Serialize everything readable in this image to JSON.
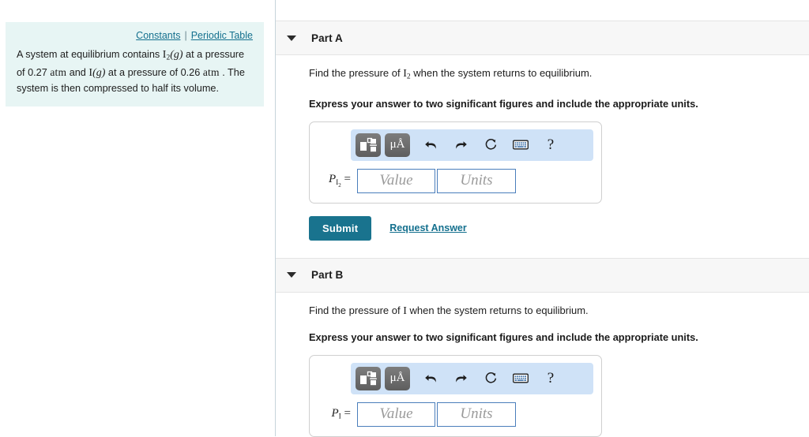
{
  "left_panel": {
    "links": [
      {
        "label": "Constants",
        "name": "constants-link"
      },
      {
        "label": "Periodic Table",
        "name": "periodic-table-link"
      }
    ],
    "link_separator": "|",
    "problem": {
      "seg1": "A system at equilibrium contains ",
      "species1": "I",
      "species1_sub": "2",
      "species1_state": "(g)",
      "seg2": " at a pressure of 0.27 ",
      "unit1": "atm",
      "seg3": " and ",
      "species2": "I",
      "species2_state": "(g)",
      "seg4": " at a pressure of 0.26 ",
      "unit2": "atm",
      "seg5": " . The system is then compressed to half its volume."
    }
  },
  "parts": [
    {
      "id": "part-a",
      "title": "Part A",
      "caret": "caret-down-icon",
      "question_pre": "Find the pressure of ",
      "question_symbol": "I",
      "question_symbol_sub": "2",
      "question_post": " when the system returns to equilibrium.",
      "instruction": "Express your answer to two significant figures and include the appropriate units.",
      "answer_label_base": "P",
      "answer_label_sub": "I",
      "answer_label_subsub": "2",
      "answer_label_equals": "=",
      "value_placeholder": "Value",
      "units_placeholder": "Units",
      "value_current": "",
      "units_current": "",
      "toolbar": {
        "template_button": "math-template-icon",
        "units_button_label": "μÅ",
        "undo": "undo-icon",
        "redo": "redo-icon",
        "reset": "reset-icon",
        "keyboard": "keyboard-icon",
        "help": "?"
      },
      "submit_label": "Submit",
      "request_label": "Request Answer",
      "has_submit": true
    },
    {
      "id": "part-b",
      "title": "Part B",
      "caret": "caret-down-icon",
      "question_pre": "Find the pressure of ",
      "question_symbol": "I",
      "question_symbol_sub": "",
      "question_post": " when the system returns to equilibrium.",
      "instruction": "Express your answer to two significant figures and include the appropriate units.",
      "answer_label_base": "P",
      "answer_label_sub": "I",
      "answer_label_subsub": "",
      "answer_label_equals": "=",
      "value_placeholder": "Value",
      "units_placeholder": "Units",
      "value_current": "",
      "units_current": "",
      "toolbar": {
        "template_button": "math-template-icon",
        "units_button_label": "μÅ",
        "undo": "undo-icon",
        "redo": "redo-icon",
        "reset": "reset-icon",
        "keyboard": "keyboard-icon",
        "help": "?"
      },
      "submit_label": "",
      "request_label": "",
      "has_submit": false
    }
  ],
  "colors": {
    "accent_teal": "#19738e",
    "link_teal": "#14708e",
    "panel_mint": "#e7f5f4",
    "toolbar_blue": "#cfe2f7",
    "field_border_blue": "#4a7ebb",
    "header_gray": "#f7f7f7"
  }
}
